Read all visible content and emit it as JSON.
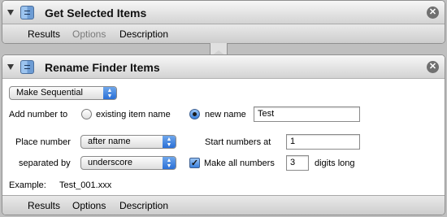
{
  "action1": {
    "title": "Get Selected Items",
    "tabs": [
      "Results",
      "Options",
      "Description"
    ]
  },
  "action2": {
    "title": "Rename Finder Items",
    "mode_popup": "Make Sequential",
    "add_number_to_label": "Add number to",
    "option_existing": "existing item name",
    "option_new": "new name",
    "new_name_value": "Test",
    "place_number_label": "Place number",
    "place_number_popup": "after name",
    "separated_by_label": "separated by",
    "separated_by_popup": "underscore",
    "start_numbers_label": "Start numbers at",
    "start_numbers_value": "1",
    "make_all_label": "Make all numbers",
    "digits_value": "3",
    "digits_long_label": "digits long",
    "example_label": "Example:",
    "example_value": "Test_001.xxx",
    "tabs": [
      "Results",
      "Options",
      "Description"
    ]
  },
  "icons": {
    "close": "close-icon",
    "disclosure": "disclosure-triangle-icon",
    "app": "automator-finder-icon"
  },
  "colors": {
    "popup_arrow_blue": "#2a6fd6",
    "background": "#bfbfbf"
  }
}
